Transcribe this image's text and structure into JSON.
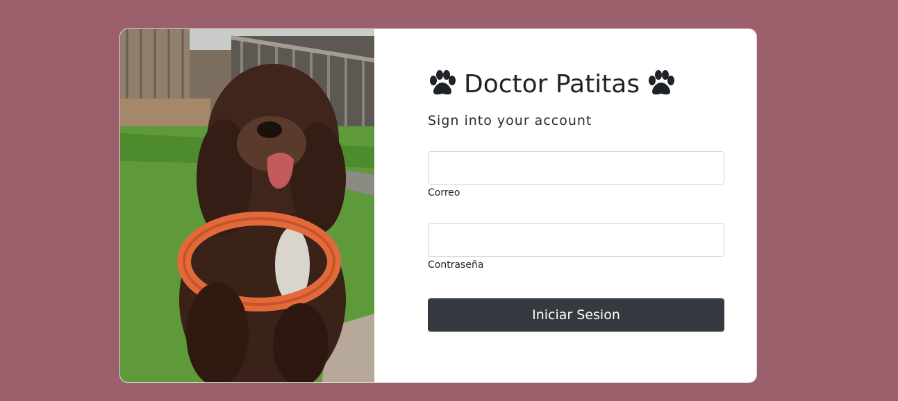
{
  "app": {
    "title": "Doctor Patitas",
    "title_icon": "paw-icon",
    "subtitle": "Sign into your account"
  },
  "form": {
    "email": {
      "value": "",
      "label": "Correo"
    },
    "password": {
      "value": "",
      "label": "Contraseña"
    },
    "submit_label": "Iniciar Sesion"
  },
  "photo": {
    "subject": "dog-with-orange-frisbee-photo"
  },
  "colors": {
    "page_background": "#9b606c",
    "card_background": "#ffffff",
    "button_background": "#343a40",
    "text_dark": "#1f2328"
  }
}
